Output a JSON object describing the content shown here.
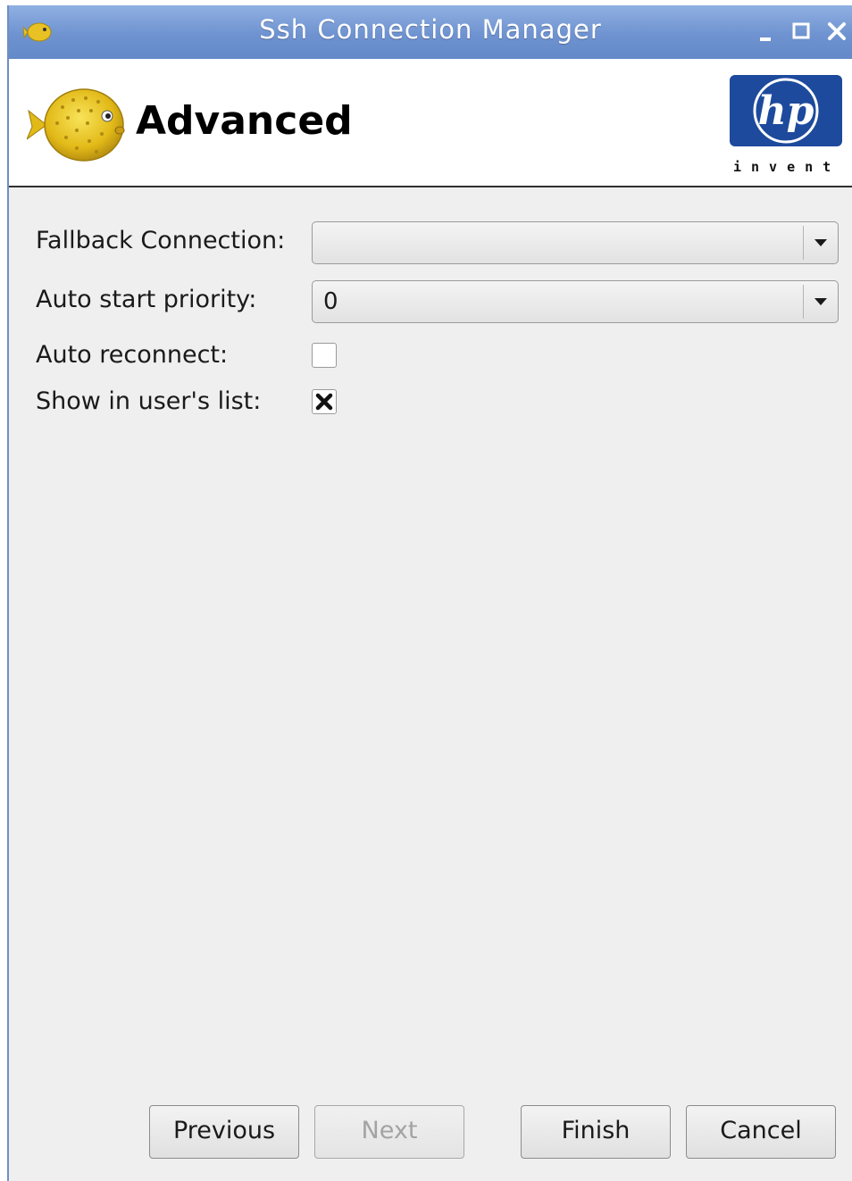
{
  "window": {
    "title": "Ssh Connection Manager"
  },
  "header": {
    "title": "Advanced",
    "logo_text": "hp",
    "logo_tagline": "invent"
  },
  "form": {
    "fallback_connection": {
      "label": "Fallback Connection:",
      "value": ""
    },
    "auto_start_priority": {
      "label": "Auto start priority:",
      "value": "0"
    },
    "auto_reconnect": {
      "label": "Auto reconnect:",
      "checked": false
    },
    "show_in_users_list": {
      "label": "Show in user's list:",
      "checked": true
    }
  },
  "buttons": {
    "previous": "Previous",
    "next": "Next",
    "finish": "Finish",
    "cancel": "Cancel"
  },
  "colors": {
    "titlebar": "#6f93d0",
    "hp_blue": "#1d4a9c",
    "fish_yellow": "#e6c21c"
  },
  "icons": {
    "app": "pufferfish-icon",
    "minimize": "minimize-icon",
    "maximize": "maximize-icon",
    "close": "close-icon",
    "dropdown": "chevron-down-icon",
    "check": "check-x-icon"
  }
}
